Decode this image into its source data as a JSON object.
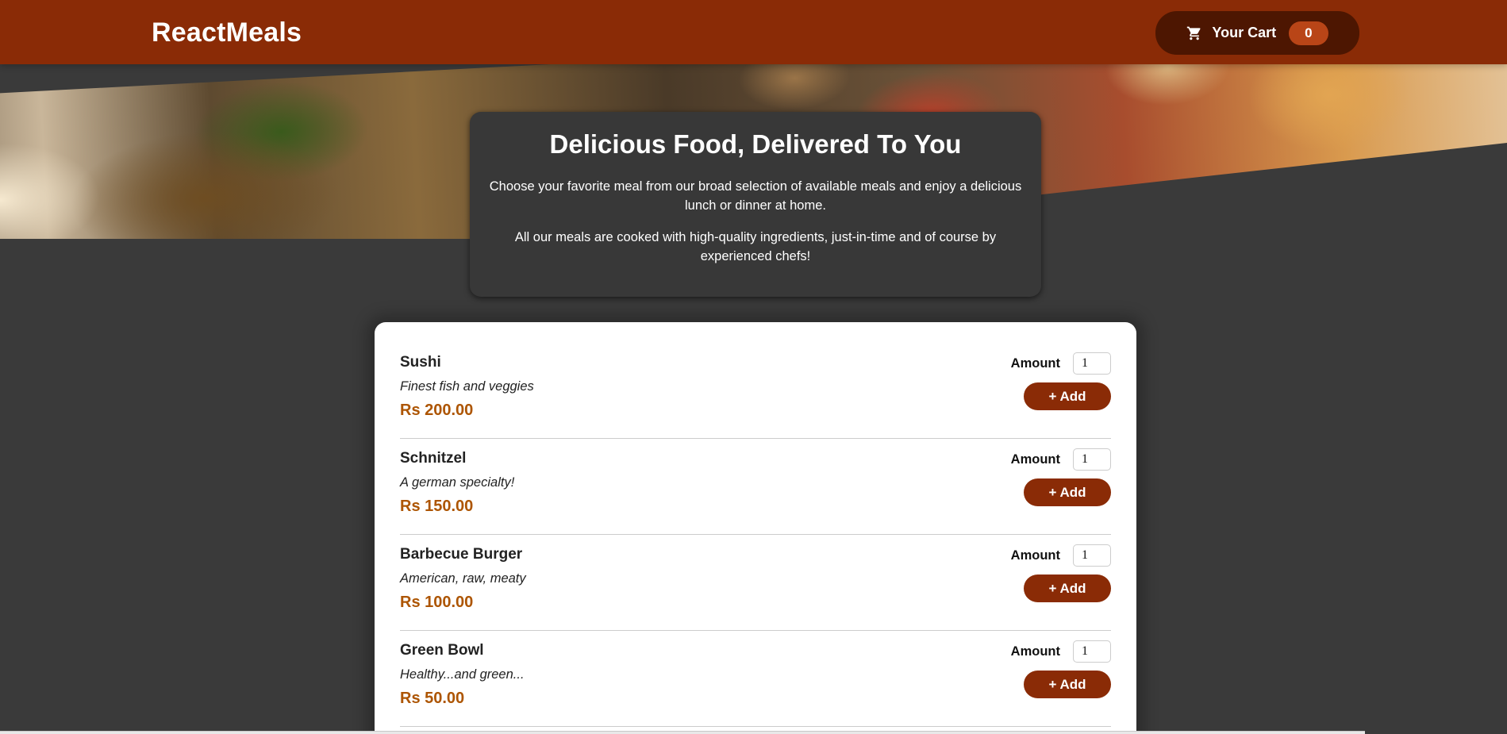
{
  "header": {
    "brand": "ReactMeals",
    "cart": {
      "label": "Your Cart",
      "count": "0"
    }
  },
  "hero": {
    "image": "catering-buffet-photo"
  },
  "summary": {
    "title": "Delicious Food, Delivered To You",
    "paragraph1": "Choose your favorite meal from our broad selection of available meals and enjoy a delicious lunch or dinner at home.",
    "paragraph2": "All our meals are cooked with high-quality ingredients, just-in-time and of course by experienced chefs!"
  },
  "meals": [
    {
      "name": "Sushi",
      "description": "Finest fish and veggies",
      "price": "Rs 200.00",
      "amount_label": "Amount",
      "amount": "1",
      "add_label": "+ Add"
    },
    {
      "name": "Schnitzel",
      "description": "A german specialty!",
      "price": "Rs 150.00",
      "amount_label": "Amount",
      "amount": "1",
      "add_label": "+ Add"
    },
    {
      "name": "Barbecue Burger",
      "description": "American, raw, meaty",
      "price": "Rs 100.00",
      "amount_label": "Amount",
      "amount": "1",
      "add_label": "+ Add"
    },
    {
      "name": "Green Bowl",
      "description": "Healthy...and green...",
      "price": "Rs 50.00",
      "amount_label": "Amount",
      "amount": "1",
      "add_label": "+ Add"
    }
  ],
  "colors": {
    "header": "#8a2b06",
    "cart_button": "#4d1601",
    "cart_badge": "#b94517",
    "background": "#383838",
    "price": "#ad5502",
    "add_button": "#8a2b06"
  }
}
